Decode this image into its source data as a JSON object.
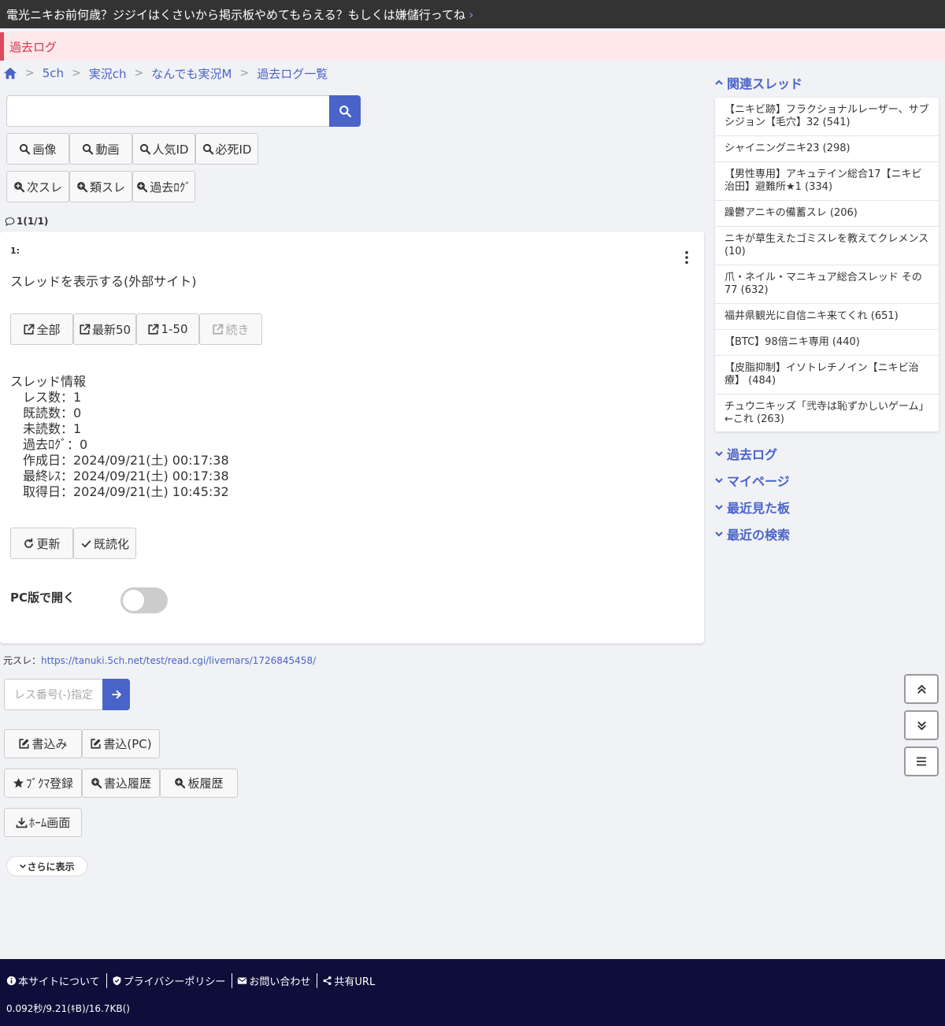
{
  "header": {
    "title": "電光ニキお前何歳？ジジイはくさいから掲示板やめてもらえる？もしくは嫌儲行ってね",
    "log_label": "過去ログ"
  },
  "breadcrumb": [
    "5ch",
    "実況ch",
    "なんでも実況M",
    "過去ログ一覧"
  ],
  "search": {
    "placeholder": ""
  },
  "search_buttons": [
    "画像",
    "動画",
    "人気ID",
    "必死ID"
  ],
  "nav_buttons": [
    "次スレ",
    "類スレ",
    "過去ﾛｸﾞ"
  ],
  "res_count": "1(1/1)",
  "post": {
    "number": "1:",
    "thread_link": "スレッドを表示する(外部サイト)",
    "view_buttons": [
      "全部",
      "最新50",
      "1-50",
      "続き"
    ],
    "info_title": "スレッド情報",
    "info_rows": [
      "レス数：1",
      "既読数：0",
      "未読数：1",
      "過去ﾛｸﾞ：0",
      "作成日：2024/09/21(土) 00:17:38",
      "最終ﾚｽ：2024/09/21(土) 00:17:38",
      "取得日：2024/09/21(土) 10:45:32"
    ],
    "action_buttons": [
      "更新",
      "既読化"
    ],
    "pc_label": "PC版で開く",
    "pc_toggle_on": false
  },
  "source": {
    "label": "元スレ：",
    "url": "https://tanuki.5ch.net/test/read.cgi/livemars/1726845458/"
  },
  "jump": {
    "placeholder": "レス番号(-)指定"
  },
  "bottom_buttons": {
    "write": "書込み",
    "write_pc": "書込(PC)",
    "bookmark": "ﾌﾞｸﾏ登録",
    "write_history": "書込履歴",
    "board_history": "板履歴",
    "home": "ﾎｰﾑ画面",
    "more": "さらに表示"
  },
  "sidebar": {
    "related_title": "関連スレッド",
    "related": [
      "【ニキビ跡】フラクショナルレーザー、サブシジョン【毛穴】32 (541)",
      "シャイニングニキ23 (298)",
      "【男性専用】アキュテイン総合17【ニキビ治田】避難所★1 (334)",
      "躁鬱アニキの備蓄スレ (206)",
      "ニキが草生えたゴミスレを教えてクレメンス (10)",
      "爪・ネイル・マニキュア総合スレッド その77 (632)",
      "福井県観光に自信ニキ来てくれ (651)",
      "【BTC】98倍ニキ専用 (440)",
      "【皮脂抑制】イソトレチノイン【ニキビ治療】 (484)",
      "チュウニキッズ「弐寺は恥ずかしいゲーム」←これ (263)"
    ],
    "sections": [
      "過去ログ",
      "マイページ",
      "最近見た板",
      "最近の検索"
    ]
  },
  "footer": {
    "links": [
      "本サイトについて",
      "プライバシーポリシー",
      "お問い合わせ",
      "共有URL"
    ],
    "stats": "0.092秒/9.21(ｷB)/16.7KB()"
  },
  "colors": {
    "accent": "#4a63c8",
    "header_bg": "#333333",
    "footer_bg": "#0e0e3a",
    "log_accent": "#e0485e"
  }
}
